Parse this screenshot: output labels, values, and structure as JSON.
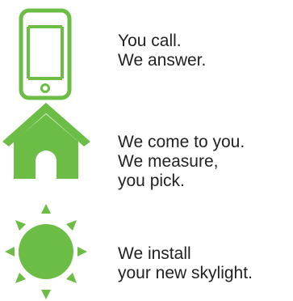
{
  "accent_color": "#6cbd45",
  "steps": [
    {
      "icon": "smartphone-icon",
      "lines": [
        "You call.",
        "We answer."
      ]
    },
    {
      "icon": "house-icon",
      "lines": [
        "We come to you.",
        "We measure,",
        "you pick."
      ]
    },
    {
      "icon": "sun-icon",
      "lines": [
        "We install",
        "your new skylight."
      ]
    }
  ]
}
